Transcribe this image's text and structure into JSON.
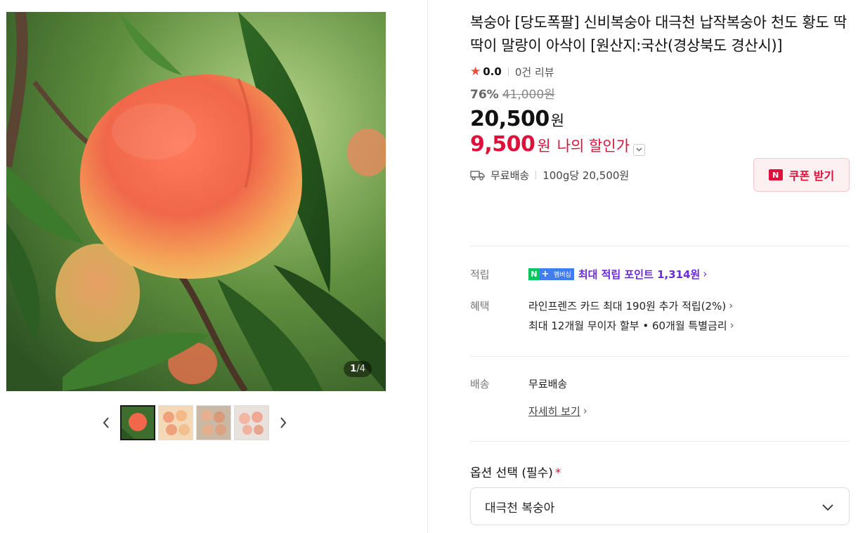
{
  "gallery": {
    "counter_current": "1",
    "counter_total": "/4",
    "prev_icon": "chevron-left-icon",
    "next_icon": "chevron-right-icon",
    "thumbnails": [
      "peach-on-tree",
      "peaches-in-box-1",
      "peaches-in-box-2",
      "peaches-in-box-3"
    ]
  },
  "product": {
    "title": "복숭아 [당도폭팔] 신비복숭아 대극천 납작복숭아 천도 황도 딱딱이 말랑이 아삭이 [원산지:국산(경상북도 경산시)]",
    "rating": "0.0",
    "review_count": "0건 리뷰",
    "discount_rate": "76%",
    "original_price": "41,000원",
    "price": "20,500",
    "price_unit": "원",
    "my_price": "9,500",
    "my_price_unit": "원",
    "my_price_label": "나의 할인가",
    "coupon_label": "쿠폰 받기",
    "shipping": "무료배송",
    "unit_price": "100g당 20,500원"
  },
  "benefits": {
    "points_label": "적립",
    "membership_badge_n": "N",
    "membership_badge_plus": "+",
    "membership_badge_text": "멤버십",
    "points_text": "최대 적립 포인트 1,314원",
    "benefit_label": "혜택",
    "benefit_line1": "라인프렌즈 카드 최대 190원 추가 적립(2%)",
    "benefit_line2": "최대 12개월 무이자 할부 • 60개월 특별금리"
  },
  "delivery": {
    "label": "배송",
    "value": "무료배송",
    "detail_link": "자세히 보기"
  },
  "options": {
    "label": "옵션 선택 (필수)",
    "required_mark": "*",
    "selected": "대극천 복숭아"
  },
  "colors": {
    "accent_red": "#e0103a",
    "points_purple": "#6a2bdc",
    "naver_green": "#03c75a"
  }
}
